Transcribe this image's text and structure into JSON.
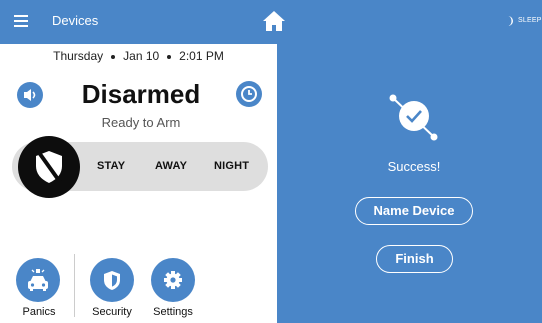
{
  "topbar": {
    "title": "Devices",
    "mode_label": "SLEEP"
  },
  "panel": {
    "day": "Thursday",
    "date": "Jan 10",
    "time": "2:01 PM",
    "status": "Disarmed",
    "substatus": "Ready to Arm",
    "modes": [
      "STAY",
      "AWAY",
      "NIGHT"
    ]
  },
  "nav": {
    "panics": "Panics",
    "security": "Security",
    "settings": "Settings"
  },
  "right": {
    "success": "Success!",
    "name_device": "Name Device",
    "finish": "Finish"
  },
  "colors": {
    "accent": "#4a86c8",
    "shield": "#0d0d0d",
    "mode_bar": "#dedede"
  }
}
